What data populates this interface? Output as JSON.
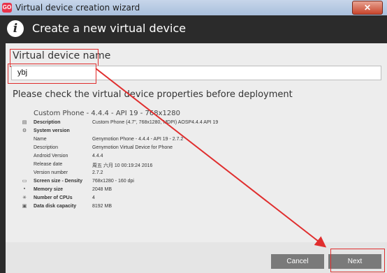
{
  "window": {
    "title": "Virtual device creation wizard",
    "icon": "genymotion-logo",
    "icon_text": "GO",
    "close_label": "✕"
  },
  "header": {
    "icon": "info-icon",
    "icon_glyph": "i",
    "title": "Create a new virtual device"
  },
  "form": {
    "name_label": "Virtual device name",
    "name_value": "ybj"
  },
  "properties": {
    "heading": "Please check the virtual device properties before deployment",
    "device": "Custom Phone - 4.4.4 - API 19 - 768x1280",
    "rows": [
      {
        "icon": "document-icon",
        "glyph": "▤",
        "label": "Description",
        "value": "Custom Phone (4.7\", 768x1280, MDPI) AOSP4.4.4 API 19",
        "bold": true
      },
      {
        "icon": "system-gear-icon",
        "glyph": "⚙",
        "label": "System version",
        "value": "",
        "bold": true
      },
      {
        "icon": "",
        "glyph": "",
        "label": "Name",
        "value": "Genymotion Phone - 4.4.4 - API 19 - 2.7.2",
        "bold": false
      },
      {
        "icon": "",
        "glyph": "",
        "label": "Description",
        "value": "Genymotion Virtual Device for Phone",
        "bold": false
      },
      {
        "icon": "",
        "glyph": "",
        "label": "Android Version",
        "value": "4.4.4",
        "bold": false
      },
      {
        "icon": "",
        "glyph": "",
        "label": "Release date",
        "value": "周五 六月 10 00:19:24 2016",
        "bold": false
      },
      {
        "icon": "",
        "glyph": "",
        "label": "Version number",
        "value": "2.7.2",
        "bold": false
      },
      {
        "icon": "monitor-icon",
        "glyph": "▭",
        "label": "Screen size - Density",
        "value": "768x1280 - 160 dpi",
        "bold": true
      },
      {
        "icon": "memory-icon",
        "glyph": "▪",
        "label": "Memory size",
        "value": "2048 MB",
        "bold": true
      },
      {
        "icon": "cpu-icon",
        "glyph": "✳",
        "label": "Number of CPUs",
        "value": "4",
        "bold": true
      },
      {
        "icon": "disk-icon",
        "glyph": "▣",
        "label": "Data disk capacity",
        "value": "8192 MB",
        "bold": true
      }
    ]
  },
  "buttons": {
    "cancel": "Cancel",
    "next": "Next"
  },
  "annotation_color": "#e02e2e"
}
